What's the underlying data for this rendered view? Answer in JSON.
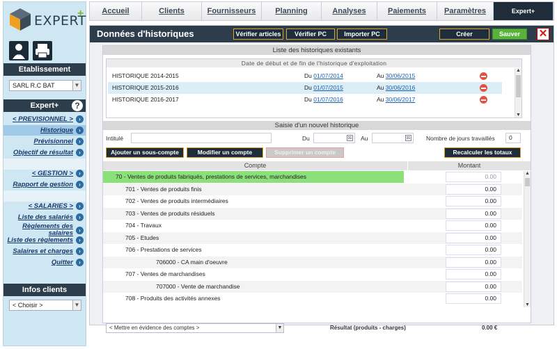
{
  "sidebar": {
    "logo_text": "EXPERT",
    "logo_plus": "+",
    "etablissement_header": "Etablissement",
    "etablissement_value": "SARL R.C BAT",
    "expert_header": "Expert+",
    "help_glyph": "?",
    "menu": [
      {
        "label": "< PREVISIONNEL >"
      },
      {
        "label": "Historique",
        "active": true
      },
      {
        "label": "Prévisionnel"
      },
      {
        "label": "Objectif de résultat"
      },
      {
        "label": "< GESTION >"
      },
      {
        "label": "Rapport de gestion"
      },
      {
        "label": "< SALARIES >"
      },
      {
        "label": "Liste des salariés"
      },
      {
        "label": "Règlements des salaires"
      },
      {
        "label": "Liste des règlements"
      },
      {
        "label": "Salaires et charges"
      },
      {
        "label": "Quitter"
      }
    ],
    "infos_header": "Infos clients",
    "choisir": "< Choisir >"
  },
  "topnav": {
    "tabs": [
      "Accueil",
      "Clients",
      "Fournisseurs",
      "Planning",
      "Analyses",
      "Paiements",
      "Paramètres",
      "Expert+"
    ]
  },
  "main": {
    "title": "Données d'historiques",
    "btn_verifier_articles": "Vérifier articles",
    "btn_verifier_pc": "Vérifier PC",
    "btn_importer_pc": "Importer PC",
    "btn_creer": "Créer",
    "btn_sauver": "Sauver",
    "close_glyph": "✕",
    "list_header": "Liste des historiques existants",
    "list_subheader": "Date de début et de fin de l'historique d'exploitation",
    "du_label": "Du",
    "au_label": "Au",
    "historiques": [
      {
        "name": "HISTORIQUE 2014-2015",
        "du": "01/07/2014",
        "au": "30/06/2015"
      },
      {
        "name": "HISTORIQUE 2015-2016",
        "du": "01/07/2015",
        "au": "30/06/2016"
      },
      {
        "name": "HISTORIQUE 2016-2017",
        "du": "01/07/2016",
        "au": "30/06/2017"
      }
    ],
    "saisie_header": "Saisie d'un nouvel historique",
    "intitule_label": "Intitulé",
    "form_du": "Du",
    "form_au": "Au",
    "jours_label": "Nombre de jours travaillés",
    "jours_value": "0",
    "cal_glyph": "31",
    "btn_ajouter": "Ajouter un sous-compte",
    "btn_modifier": "Modifier un compte",
    "btn_supprimer": "Supprimer un compte",
    "btn_recalculer": "Recalculer les totaux",
    "col_compte": "Compte",
    "col_montant": "Montant",
    "comptes": [
      {
        "label": "70 - Ventes de produits fabriqués, prestations de services, marchandises",
        "montant": "0.00",
        "level": 0
      },
      {
        "label": "701 - Ventes de produits finis",
        "montant": "0.00",
        "level": 1
      },
      {
        "label": "702 - Ventes de produits intermédiaires",
        "montant": "0.00",
        "level": 1
      },
      {
        "label": "703 - Ventes de produits résiduels",
        "montant": "0.00",
        "level": 1
      },
      {
        "label": "704 - Travaux",
        "montant": "0.00",
        "level": 1
      },
      {
        "label": "705 - Etudes",
        "montant": "0.00",
        "level": 1
      },
      {
        "label": "706 - Prestations de services",
        "montant": "0.00",
        "level": 1
      },
      {
        "label": "706000 - CA main d'oeuvre",
        "montant": "0.00",
        "level": 2
      },
      {
        "label": "707 - Ventes de marchandises",
        "montant": "0.00",
        "level": 1
      },
      {
        "label": "707000 - Vente de marchandise",
        "montant": "0.00",
        "level": 2
      },
      {
        "label": "708 - Produits des activités annexes",
        "montant": "0.00",
        "level": 1
      }
    ],
    "footer_select": "< Mettre en évidence des comptes >",
    "resultat_label": "Résultat (produits - charges)",
    "resultat_value": "0.00 €"
  }
}
